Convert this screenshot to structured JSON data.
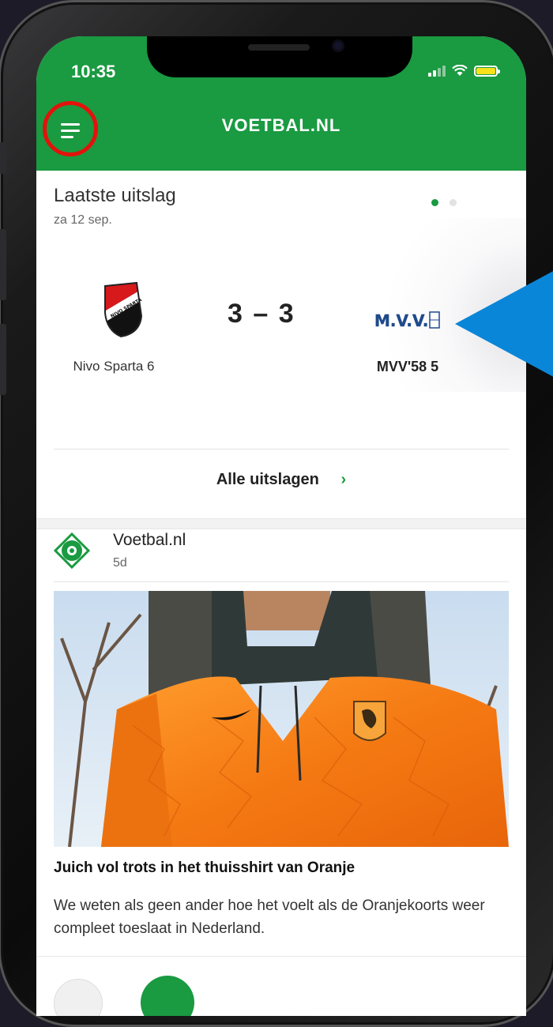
{
  "status_bar": {
    "time": "10:35"
  },
  "app_bar": {
    "title": "VOETBAL.NL"
  },
  "latest_result": {
    "heading": "Laatste uitslag",
    "date": "za 12 sep.",
    "home_team": "Nivo Sparta 6",
    "away_team": "MVV'58 5",
    "score": "3 – 3",
    "carousel_active_page": 1,
    "carousel_pages": 2,
    "all_results_label": "Alle uitslagen",
    "chevron": "›"
  },
  "news_post": {
    "source": "Voetbal.nl",
    "age": "5d",
    "title": "Juich vol trots in het thuisshirt van Oranje",
    "body": "We weten als geen ander hoe het voelt als de Oranjekoorts weer compleet toeslaat in Nederland."
  },
  "colors": {
    "brand_green": "#1a9a41",
    "highlight_red": "#e3120b",
    "arrow_blue": "#0a86d8",
    "oranje": "#f57a13"
  },
  "icons": [
    "menu-icon",
    "signal-icon",
    "wifi-icon",
    "battery-icon",
    "chevron-right-icon",
    "soccer-ball-icon"
  ]
}
